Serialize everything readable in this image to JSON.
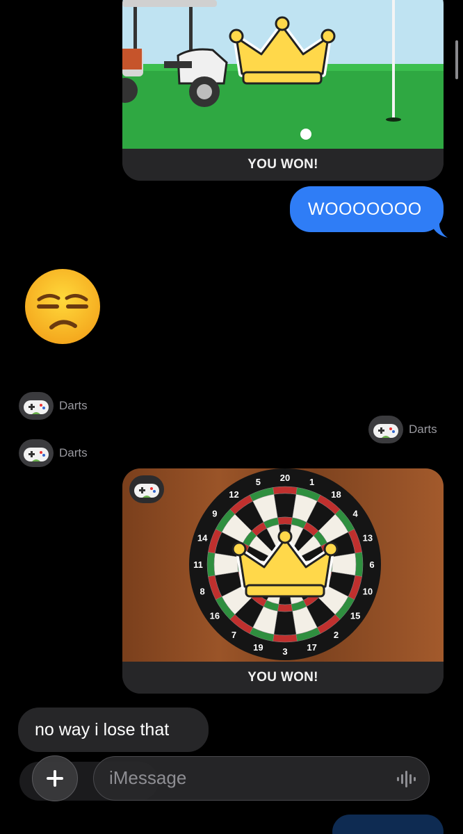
{
  "colors": {
    "background": "#000000",
    "outgoing_bubble": "#2f7df6",
    "incoming_bubble": "#262628",
    "secondary_text": "#9a9aa0"
  },
  "messages": {
    "golf_result": {
      "caption": "YOU WON!"
    },
    "outgoing_1": {
      "text": "WOOOOOOO"
    },
    "incoming_emoji": {
      "icon": "unamused-face-emoji"
    },
    "sender_darts_1": {
      "label": "Darts"
    },
    "sender_darts_2": {
      "label": "Darts"
    },
    "sender_darts_3": {
      "label": "Darts"
    },
    "darts_result": {
      "caption": "YOU WON!",
      "board_numbers": [
        "20",
        "1",
        "18",
        "4",
        "13",
        "6",
        "10",
        "15",
        "2",
        "17",
        "3",
        "19",
        "7",
        "16",
        "8",
        "11",
        "14",
        "9",
        "12",
        "5"
      ]
    },
    "incoming_text": {
      "text": "no way i lose that"
    }
  },
  "compose": {
    "placeholder": "iMessage",
    "add_icon": "plus-icon",
    "mic_icon": "audio-waveform-icon"
  }
}
